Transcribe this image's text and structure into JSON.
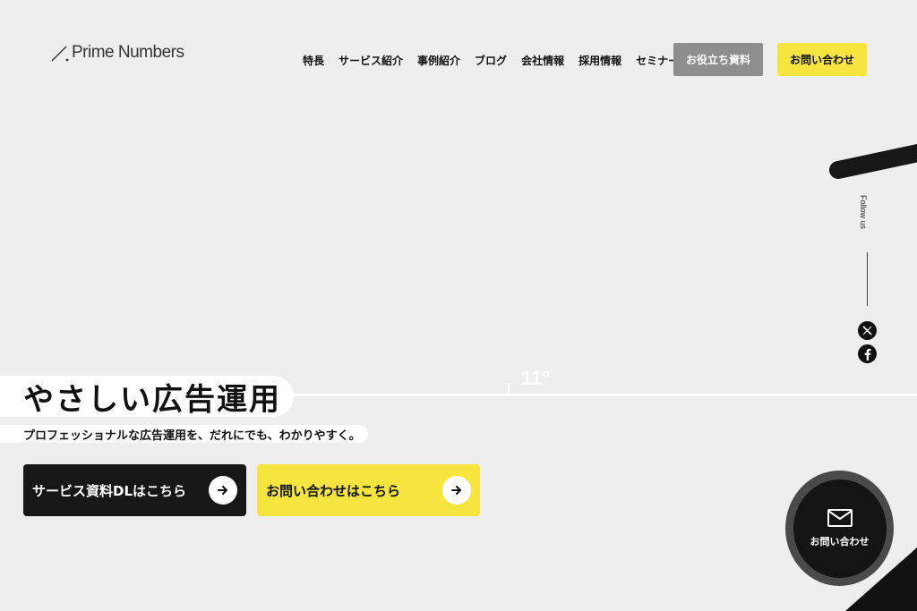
{
  "brand": {
    "name": "Prime Numbers"
  },
  "nav": {
    "items": [
      "特長",
      "サービス紹介",
      "事例紹介",
      "ブログ",
      "会社情報",
      "採用情報",
      "セミナー"
    ],
    "docs_button": "お役立ち資料",
    "contact_button": "お問い合わせ"
  },
  "social": {
    "follow_label": "Follow us",
    "icons": [
      "x-icon",
      "facebook-icon"
    ]
  },
  "hero": {
    "degree": "11°",
    "title": "やさしい広告運用",
    "subtitle": "プロフェッショナルな広告運用を、だれにでも、わかりやすく。"
  },
  "cta": {
    "download_label": "サービス資料DLはこちら",
    "contact_label": "お問い合わせはこちら"
  },
  "floating": {
    "contact_label": "お問い合わせ"
  },
  "colors": {
    "accent": "#f7e53f",
    "dark": "#171717",
    "gray_button": "#8e8e8e",
    "background": "#eeeeee"
  }
}
